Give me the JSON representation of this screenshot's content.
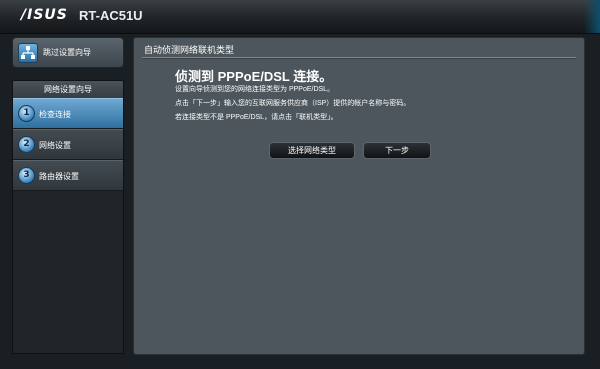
{
  "header": {
    "logo": "/ISUS",
    "model": "RT-AC51U"
  },
  "sidebar": {
    "quick_setup": "跳过设置向导",
    "wizard_title": "网络设置向导",
    "steps": [
      {
        "num": "1",
        "label": "检查连接",
        "active": true
      },
      {
        "num": "2",
        "label": "网络设置",
        "active": false
      },
      {
        "num": "3",
        "label": "路由器设置",
        "active": false
      }
    ]
  },
  "main": {
    "title": "自动侦测网络联机类型",
    "heading": "侦测到 PPPoE/DSL 连接。",
    "lines": [
      "设置向导侦测到您的网络连接类型为 PPPoE/DSL。",
      "点击「下一步」输入您的互联网服务供应商（ISP）提供的帐户名称与密码。",
      "若连接类型不是 PPPoE/DSL，请点击「联机类型」。"
    ],
    "buttons": {
      "select_type": "选择网络类型",
      "next": "下一步"
    }
  },
  "colors": {
    "accent": "#2f6f9e",
    "panel": "#4d565c",
    "background": "#1a1f23"
  }
}
